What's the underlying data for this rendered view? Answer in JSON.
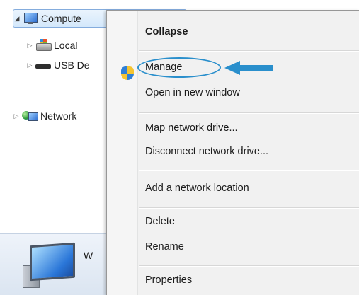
{
  "nav_tree": {
    "items": [
      {
        "label": "Compute",
        "icon": "computer-icon",
        "expanded": true,
        "selected": true
      },
      {
        "label": "Local",
        "icon": "local-drive-icon",
        "expanded": false
      },
      {
        "label": "USB De",
        "icon": "usb-drive-icon",
        "expanded": false
      },
      {
        "label": "Network",
        "icon": "network-icon",
        "expanded": false
      }
    ]
  },
  "details_pane": {
    "text": "W",
    "icon": "computer-large-icon"
  },
  "context_menu": {
    "items": [
      {
        "label": "Collapse",
        "bold": true
      },
      {
        "label": "Manage",
        "icon": "uac-shield-icon",
        "highlighted": true
      },
      {
        "label": "Open in new window"
      },
      {
        "label": "Map network drive..."
      },
      {
        "label": "Disconnect network drive..."
      },
      {
        "label": "Add a network location"
      },
      {
        "label": "Delete"
      },
      {
        "label": "Rename"
      },
      {
        "label": "Properties"
      }
    ]
  },
  "annotation": {
    "color": "#2a8fcc",
    "shape": "ellipse-with-arrow",
    "target": "Manage"
  }
}
